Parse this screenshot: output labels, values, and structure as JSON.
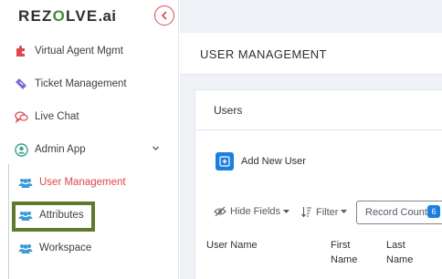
{
  "app": {
    "logo_prefix": "REZ",
    "logo_o": "O",
    "logo_suffix": "LVE",
    "logo_ai": ".ai"
  },
  "sidebar": {
    "items": [
      {
        "label": "Virtual Agent Mgmt",
        "icon": "puzzle-icon"
      },
      {
        "label": "Ticket Management",
        "icon": "ticket-icon"
      },
      {
        "label": "Live Chat",
        "icon": "chat-icon"
      },
      {
        "label": "Admin App",
        "icon": "admin-user-icon"
      },
      {
        "label": "User Management",
        "icon": "users-icon",
        "active": true
      },
      {
        "label": "Attributes",
        "icon": "users-icon"
      },
      {
        "label": "Workspace",
        "icon": "users-icon"
      }
    ]
  },
  "main": {
    "page_title": "USER MANAGEMENT",
    "card_title": "Users",
    "add_button": "Add New User",
    "toolbar": {
      "hide_fields": "Hide Fields",
      "filter": "Filter",
      "record_count": "Record Count",
      "record_badge": "6"
    },
    "table": {
      "headers": [
        "User Name",
        "First Name",
        "Last Name"
      ]
    }
  },
  "colors": {
    "accent_red": "#e0474c",
    "primary_blue": "#1a7fe0",
    "icon_blue": "#3a9ad9",
    "highlight_green": "#5d7a2d",
    "background": "#eef1f6"
  }
}
